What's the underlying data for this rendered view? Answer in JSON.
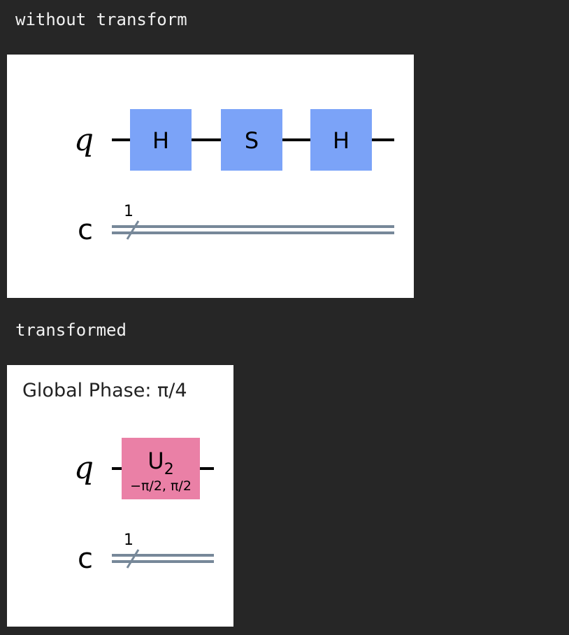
{
  "outputs": [
    {
      "label": "without transform",
      "circuit": {
        "qubit_label": "q",
        "clbit_label": "c",
        "clbit_count": "1",
        "gates": [
          {
            "name": "H",
            "color": "#7ba3f8"
          },
          {
            "name": "S",
            "color": "#7ba3f8"
          },
          {
            "name": "H",
            "color": "#7ba3f8"
          }
        ]
      }
    },
    {
      "label": "transformed",
      "circuit": {
        "global_phase": "Global Phase: π/4",
        "qubit_label": "q",
        "clbit_label": "c",
        "clbit_count": "1",
        "gates": [
          {
            "name": "U",
            "subscript": "2",
            "params": "−π/2, π/2",
            "color": "#ea80a6"
          }
        ]
      }
    }
  ],
  "colors": {
    "background": "#262626",
    "figure_background": "#ffffff",
    "classical_wire": "#778899",
    "quantum_wire": "#000000"
  }
}
